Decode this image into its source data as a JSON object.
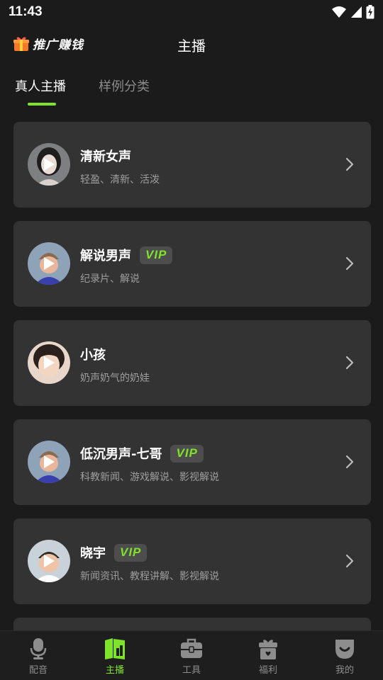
{
  "status_bar": {
    "time": "11:43"
  },
  "header": {
    "promo_label": "推广赚钱",
    "title": "主播"
  },
  "tabs": [
    {
      "label": "真人主播",
      "active": true
    },
    {
      "label": "样例分类",
      "active": false
    }
  ],
  "voices": [
    {
      "name": "清新女声",
      "desc": "轻盈、清新、活泼",
      "vip": false,
      "avatar": "woman-avatar"
    },
    {
      "name": "解说男声",
      "desc": "纪录片、解说",
      "vip": true,
      "vip_label": "VIP",
      "avatar": "cartoon-man-avatar"
    },
    {
      "name": "小孩",
      "desc": "奶声奶气的奶娃",
      "vip": false,
      "avatar": "child-avatar"
    },
    {
      "name": "低沉男声-七哥",
      "desc": "科教新闻、游戏解说、影视解说",
      "vip": true,
      "vip_label": "VIP",
      "avatar": "cartoon-man-avatar"
    },
    {
      "name": "晓宇",
      "desc": "新闻资讯、教程讲解、影视解说",
      "vip": true,
      "vip_label": "VIP",
      "avatar": "cartoon-boy-avatar"
    }
  ],
  "bottom_nav": [
    {
      "label": "配音",
      "icon": "microphone-icon",
      "active": false
    },
    {
      "label": "主播",
      "icon": "anchor-book-icon",
      "active": true
    },
    {
      "label": "工具",
      "icon": "toolbox-icon",
      "active": false
    },
    {
      "label": "福利",
      "icon": "gift-icon",
      "active": false
    },
    {
      "label": "我的",
      "icon": "profile-face-icon",
      "active": false
    }
  ],
  "colors": {
    "accent": "#7ee32a",
    "card_bg": "#333333",
    "page_bg": "#1b1b1b"
  }
}
